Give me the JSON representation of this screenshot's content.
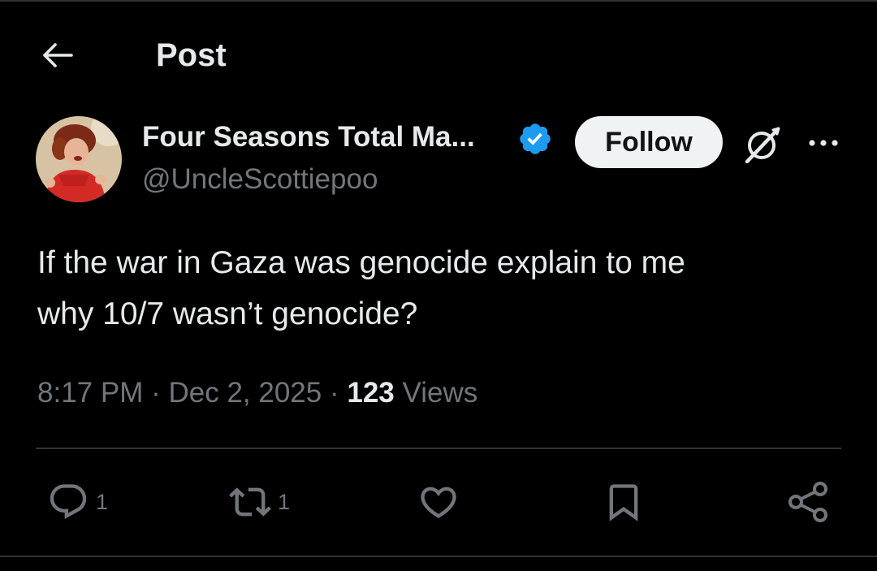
{
  "header": {
    "title": "Post"
  },
  "author": {
    "display_name": "Four Seasons Total Ma...",
    "handle": "@UncleScottiepoo",
    "verified": true,
    "follow_label": "Follow"
  },
  "post": {
    "text": "If the war in Gaza was genocide explain to me\nwhy 10/7 wasn’t genocide?",
    "time": "8:17 PM",
    "date": "Dec 2, 2025",
    "separator": "·",
    "views_count": "123",
    "views_label": "Views"
  },
  "actions": {
    "replies": "1",
    "reposts": "1"
  },
  "colors": {
    "background": "#000000",
    "text": "#e7e9ea",
    "secondary": "#71767b",
    "verified": "#1d9bf0",
    "divider": "#2f3336",
    "follow_bg": "#eff3f4"
  },
  "icons": {
    "back": "arrow-left-icon",
    "verified": "verified-badge-icon",
    "grok": "grok-icon",
    "more": "more-horizontal-icon",
    "reply": "reply-icon",
    "repost": "repost-icon",
    "like": "heart-icon",
    "bookmark": "bookmark-icon",
    "share": "share-icon"
  }
}
